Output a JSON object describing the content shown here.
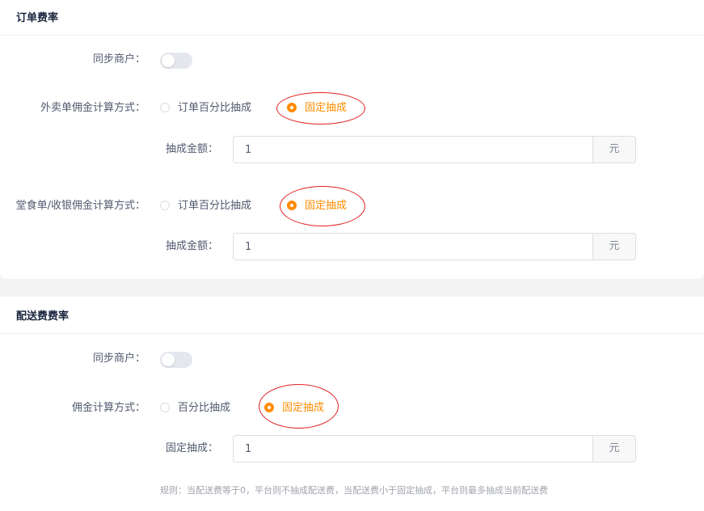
{
  "order_rate": {
    "title": "订单费率",
    "sync_label": "同步商户：",
    "takeout": {
      "label": "外卖单佣金计算方式：",
      "option1": "订单百分比抽成",
      "option2": "固定抽成",
      "amount_label": "抽成金额：",
      "amount_value": "1",
      "unit": "元"
    },
    "dinein": {
      "label": "堂食单/收银佣金计算方式：",
      "option1": "订单百分比抽成",
      "option2": "固定抽成",
      "amount_label": "抽成金额：",
      "amount_value": "1",
      "unit": "元"
    }
  },
  "delivery_rate": {
    "title": "配送费费率",
    "sync_label": "同步商户：",
    "method_label": "佣金计算方式：",
    "option1": "百分比抽成",
    "option2": "固定抽成",
    "fixed_label": "固定抽成：",
    "fixed_value": "1",
    "unit": "元",
    "rule": "规则：当配送费等于0，平台则不抽成配送费，当配送费小于固定抽成，平台则最多抽成当前配送费"
  },
  "colors": {
    "accent": "#ff8c00",
    "annotation": "#e02020"
  }
}
